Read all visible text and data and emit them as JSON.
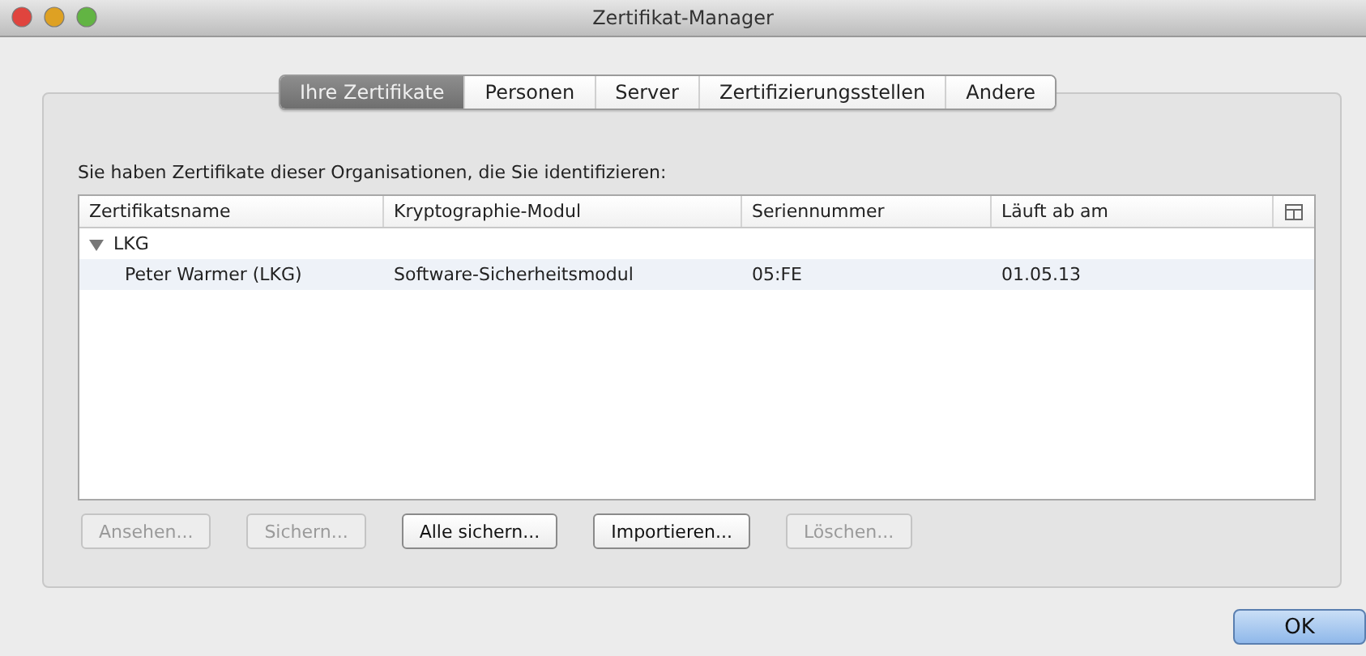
{
  "window": {
    "title": "Zertifikat-Manager"
  },
  "tabs": [
    {
      "label": "Ihre Zertifikate",
      "selected": true
    },
    {
      "label": "Personen",
      "selected": false
    },
    {
      "label": "Server",
      "selected": false
    },
    {
      "label": "Zertifizierungsstellen",
      "selected": false
    },
    {
      "label": "Andere",
      "selected": false
    }
  ],
  "intro": "Sie haben Zertifikate dieser Organisationen, die Sie identifizieren:",
  "table": {
    "columns": [
      "Zertifikatsname",
      "Kryptographie-Modul",
      "Seriennummer",
      "Läuft ab am"
    ],
    "rows": [
      {
        "name": "LKG",
        "expanded": true,
        "children": [
          {
            "cells": [
              "Peter Warmer (LKG)",
              "Software-Sicherheitsmodul",
              "05:FE",
              "01.05.13"
            ],
            "selected": false
          }
        ]
      }
    ]
  },
  "buttons": [
    {
      "label": "Ansehen...",
      "disabled": true
    },
    {
      "label": "Sichern...",
      "disabled": true
    },
    {
      "label": "Alle sichern...",
      "disabled": false
    },
    {
      "label": "Importieren...",
      "disabled": false
    },
    {
      "label": "Löschen...",
      "disabled": true
    }
  ],
  "ok_button": {
    "label": "OK"
  }
}
